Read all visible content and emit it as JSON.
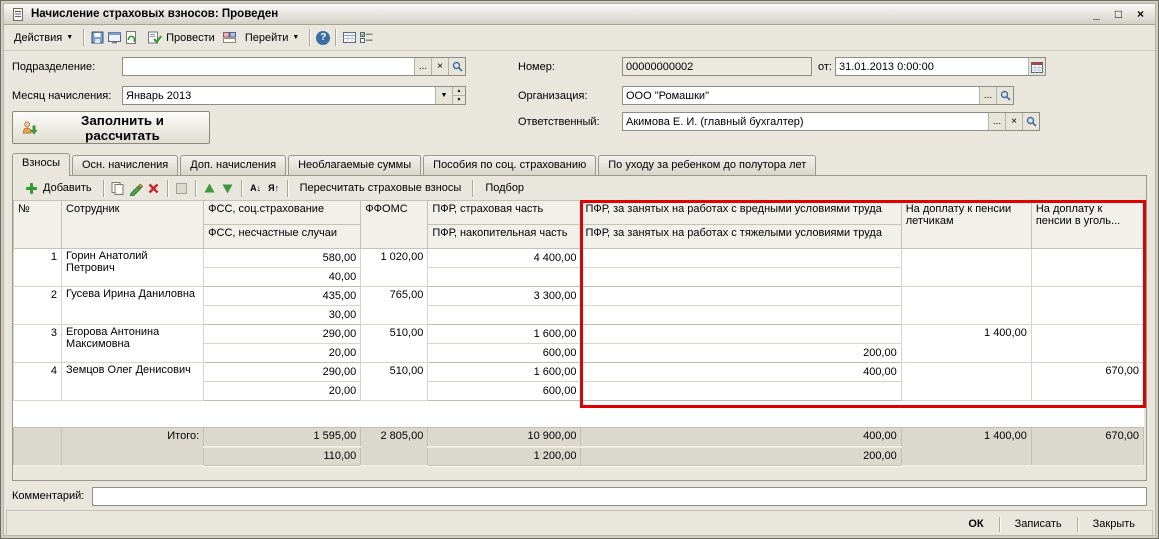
{
  "window": {
    "title": "Начисление страховых взносов: Проведен"
  },
  "icons": {
    "caret_down": "▼",
    "ellipsis": "...",
    "clear": "×",
    "minimize": "_",
    "maximize": "□",
    "close": "×",
    "help": "?",
    "sort_asc": "А↓",
    "sort_desc": "Я↑",
    "spin_up": "▲",
    "spin_down": "▼"
  },
  "toolbar": {
    "actions": "Действия",
    "post": "Провести",
    "goto": "Перейти"
  },
  "form": {
    "subdivision": {
      "label": "Подразделение:",
      "value": ""
    },
    "month": {
      "label": "Месяц начисления:",
      "value": "Январь 2013"
    },
    "number": {
      "label": "Номер:",
      "value": "00000000002"
    },
    "date": {
      "label": "от:",
      "value": "31.01.2013 0:00:00"
    },
    "organization": {
      "label": "Организация:",
      "value": "ООО \"Ромашки\""
    },
    "responsible": {
      "label": "Ответственный:",
      "value": "Акимова Е. И. (главный бухгалтер)"
    },
    "fill_button": "Заполнить и рассчитать"
  },
  "tabs": [
    {
      "label": "Взносы"
    },
    {
      "label": "Осн. начисления"
    },
    {
      "label": "Доп. начисления"
    },
    {
      "label": "Необлагаемые суммы"
    },
    {
      "label": "Пособия по соц. страхованию"
    },
    {
      "label": "По уходу за ребенком до полутора лет"
    }
  ],
  "grid_toolbar": {
    "add": "Добавить",
    "recalculate": "Пересчитать страховые взносы",
    "pick": "Подбор"
  },
  "grid": {
    "headers": {
      "num": "№",
      "employee": "Сотрудник",
      "fss_top": "ФСС, соц.страхование",
      "fss_bottom": "ФСС, несчастные случаи",
      "ffoms": "ФФОМС",
      "pfr_top": "ПФР, страховая часть",
      "pfr_bottom": "ПФР, накопительная часть",
      "harmful_top": "ПФР, за занятых на работах с вредными условиями труда",
      "harmful_bottom": "ПФР, за занятых на работах с тяжелыми условиями труда",
      "pilots": "На доплату к пенсии летчикам",
      "coal": "На доплату к пенсии в уголь..."
    },
    "rows": [
      {
        "num": "1",
        "employee": "Горин Анатолий Петрович",
        "fss_top": "580,00",
        "fss_bottom": "40,00",
        "ffoms": "1 020,00",
        "pfr_top": "4 400,00",
        "pfr_bottom": "",
        "harmful_top": "",
        "harmful_bottom": "",
        "pilots": "",
        "coal": ""
      },
      {
        "num": "2",
        "employee": "Гусева Ирина Даниловна",
        "fss_top": "435,00",
        "fss_bottom": "30,00",
        "ffoms": "765,00",
        "pfr_top": "3 300,00",
        "pfr_bottom": "",
        "harmful_top": "",
        "harmful_bottom": "",
        "pilots": "",
        "coal": ""
      },
      {
        "num": "3",
        "employee": "Егорова Антонина Максимовна",
        "fss_top": "290,00",
        "fss_bottom": "20,00",
        "ffoms": "510,00",
        "pfr_top": "1 600,00",
        "pfr_bottom": "600,00",
        "harmful_top": "",
        "harmful_bottom": "200,00",
        "pilots": "1 400,00",
        "coal": ""
      },
      {
        "num": "4",
        "employee": "Земцов Олег Денисович",
        "fss_top": "290,00",
        "fss_bottom": "20,00",
        "ffoms": "510,00",
        "pfr_top": "1 600,00",
        "pfr_bottom": "600,00",
        "harmful_top": "400,00",
        "harmful_bottom": "",
        "pilots": "",
        "coal": "670,00"
      }
    ],
    "totals": {
      "label": "Итого:",
      "fss_top": "1 595,00",
      "fss_bottom": "110,00",
      "ffoms": "2 805,00",
      "pfr_top": "10 900,00",
      "pfr_bottom": "1 200,00",
      "harmful_top": "400,00",
      "harmful_bottom": "200,00",
      "pilots": "1 400,00",
      "coal": "670,00"
    }
  },
  "comment": {
    "label": "Комментарий:",
    "value": ""
  },
  "footer": {
    "ok": "ОК",
    "write": "Записать",
    "close": "Закрыть"
  },
  "annotation_color": "#e10000"
}
